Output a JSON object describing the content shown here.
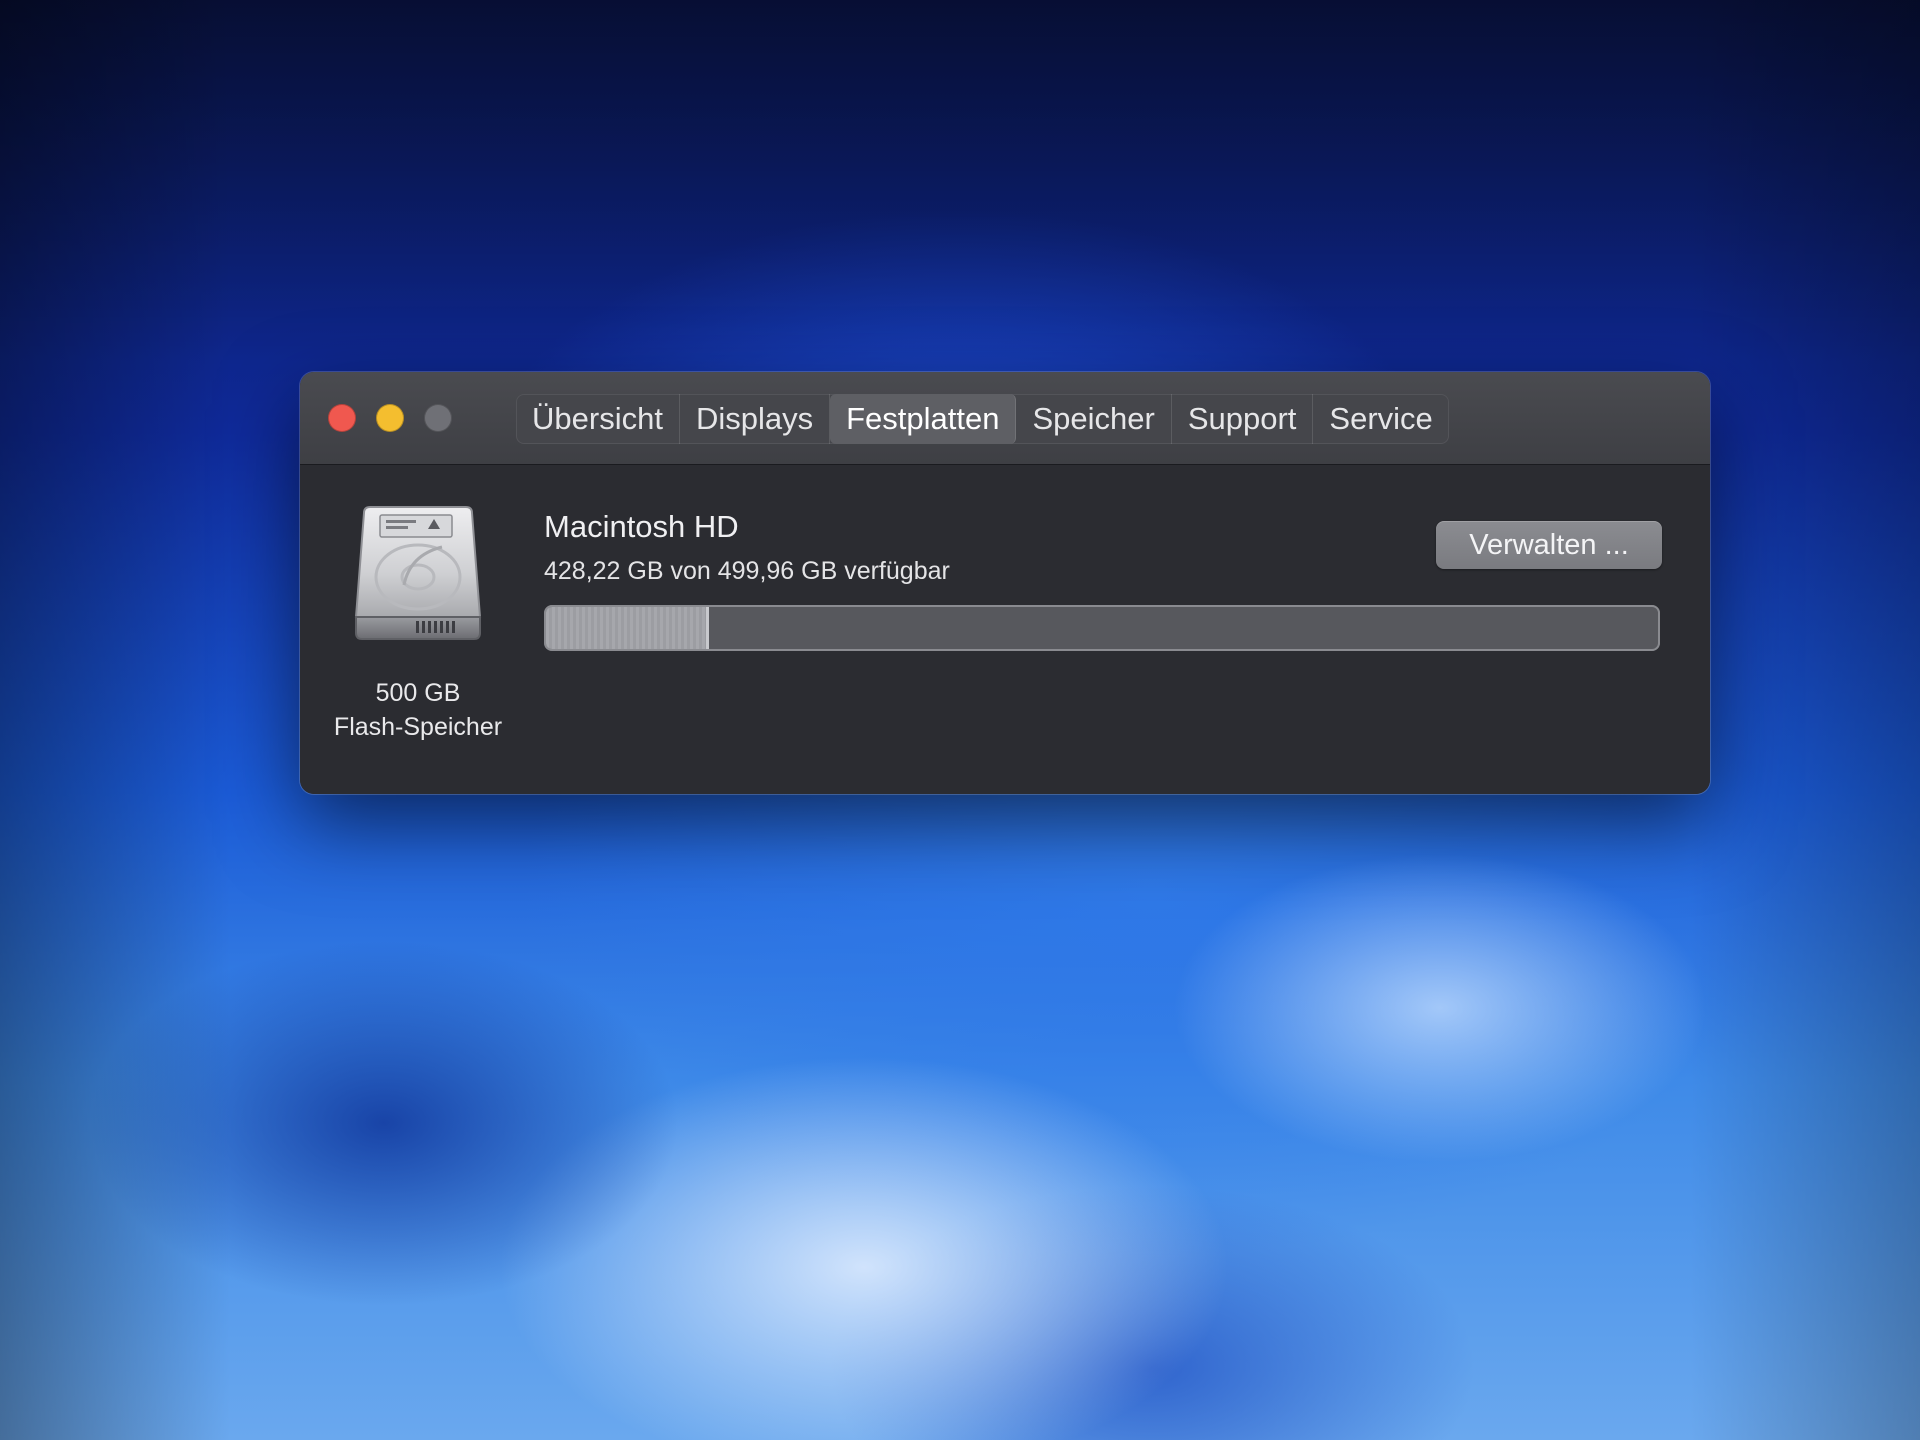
{
  "window": {
    "tabs": [
      {
        "label": "Übersicht",
        "active": false
      },
      {
        "label": "Displays",
        "active": false
      },
      {
        "label": "Festplatten",
        "active": true
      },
      {
        "label": "Speicher",
        "active": false
      },
      {
        "label": "Support",
        "active": false
      },
      {
        "label": "Service",
        "active": false
      }
    ]
  },
  "disk": {
    "icon": "hard-drive-icon",
    "capacity": "500 GB",
    "type": "Flash-Speicher"
  },
  "volume": {
    "name": "Macintosh HD",
    "availability": "428,22 GB von 499,96 GB verfügbar",
    "used_fraction": 0.143,
    "manage_label": "Verwalten ..."
  },
  "colors": {
    "close": "#f0584f",
    "minimize": "#f4be2f",
    "zoom": "#6f7076",
    "window_bg": "#2b2c31",
    "titlebar_bg": "#45464b"
  }
}
